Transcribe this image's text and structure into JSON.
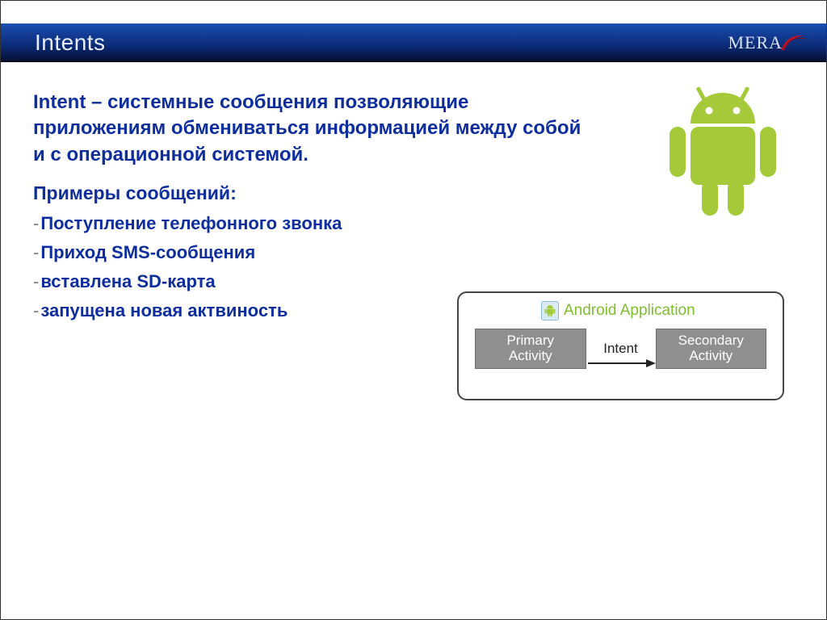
{
  "header": {
    "title": "Intents",
    "logo_text": "MERA"
  },
  "body": {
    "term": "Intent",
    "definition": " – системные сообщения позволяющие приложениям обмениваться информацией между собой и с операционной системой.",
    "examples_label": "Примеры сообщений:",
    "bullets": [
      "Поступление телефонного звонка",
      "Приход SMS-сообщения",
      "вставлена SD-карта",
      "запущена новая актвиность"
    ]
  },
  "diagram": {
    "title": "Android Application",
    "box1_line1": "Primary",
    "box1_line2": "Activity",
    "arrow_label": "Intent",
    "box2_line1": "Secondary",
    "box2_line2": "Activity"
  },
  "icons": {
    "android_robot": "android-robot-icon",
    "mini_android": "mini-android-icon",
    "logo_swoosh": "mera-swoosh-icon"
  }
}
